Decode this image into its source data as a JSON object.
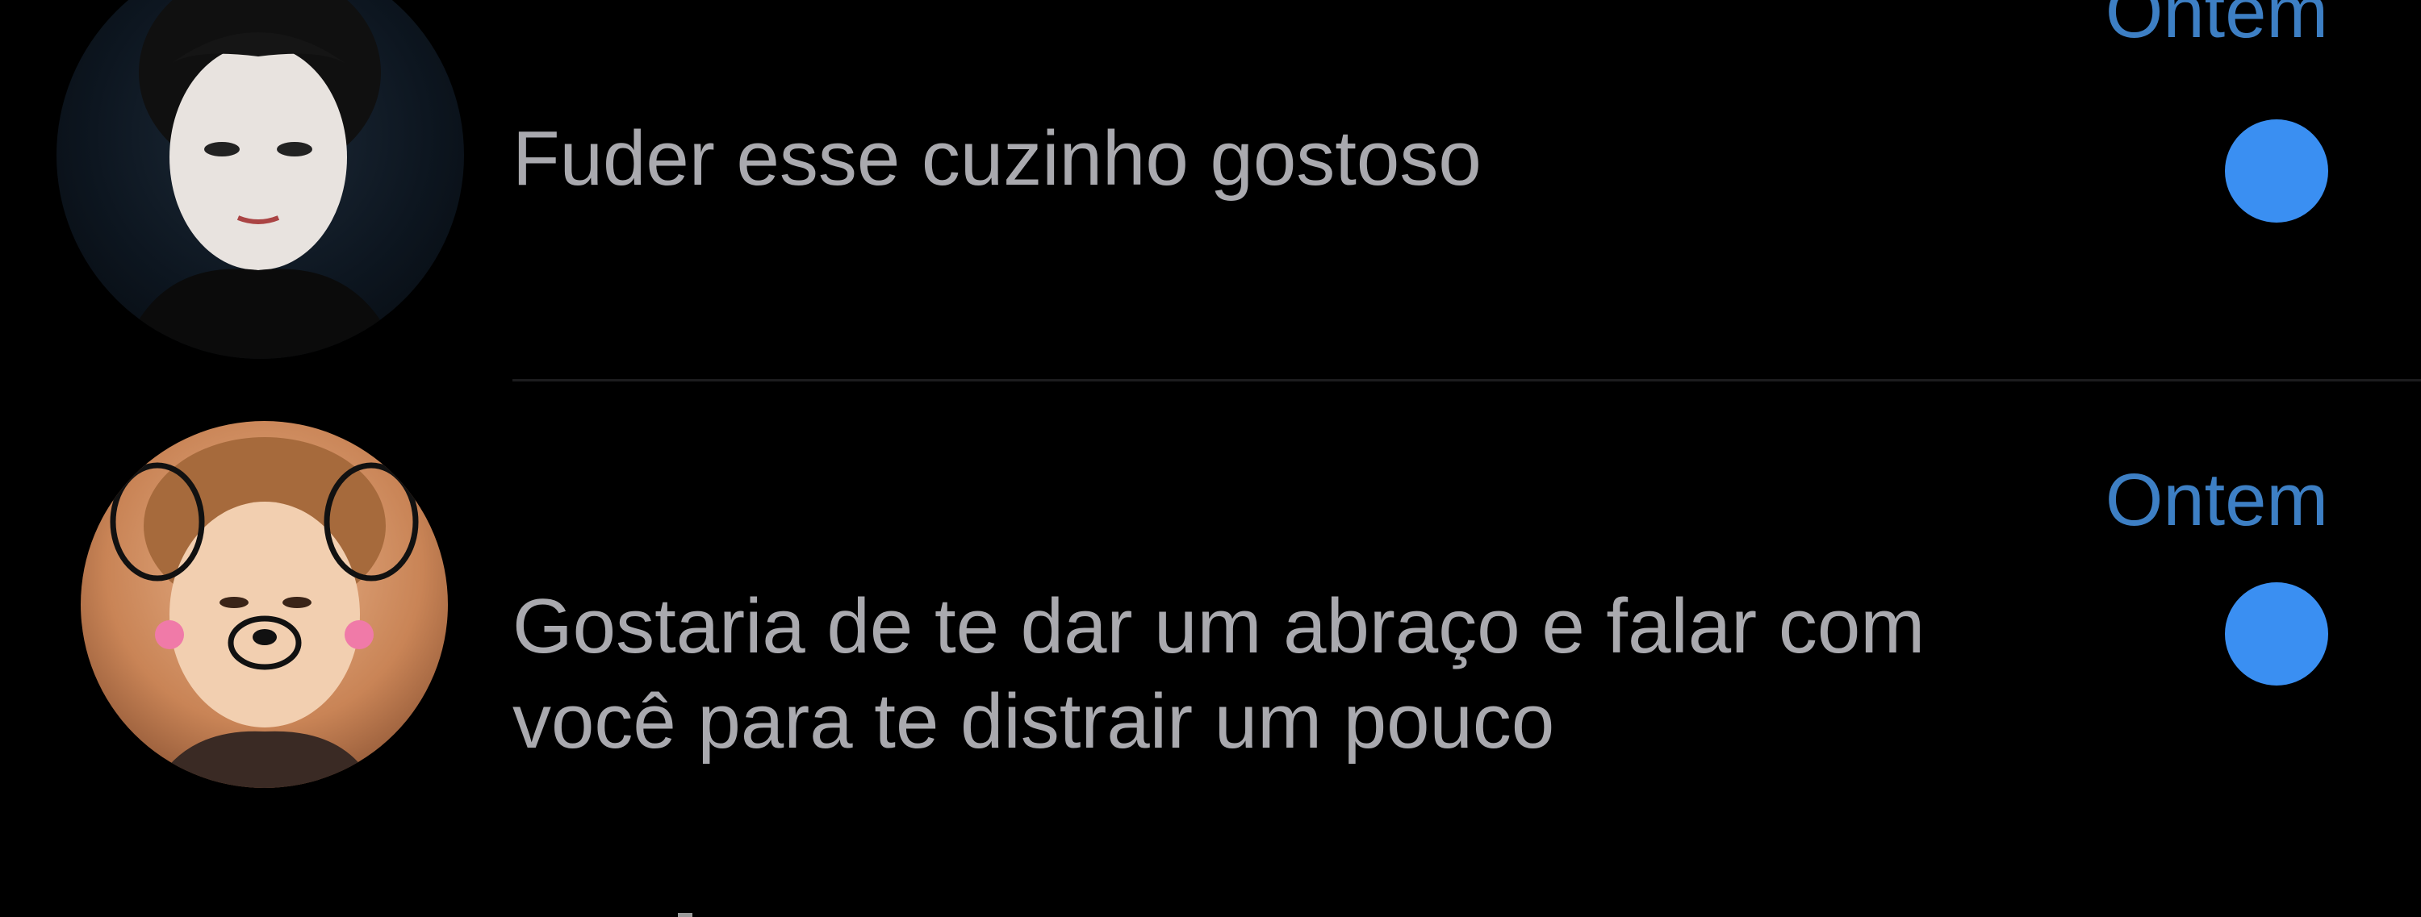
{
  "conversations": [
    {
      "avatar": "profile-photo",
      "timestamp": "Ontem",
      "message": "Fuder esse cuzinho gostoso",
      "unread": true
    },
    {
      "avatar": "profile-photo",
      "timestamp": "Ontem",
      "message": "Gostaria de te dar um abraço e falar com você para te distrair um pouco",
      "unread": true
    }
  ],
  "colors": {
    "background": "#000000",
    "message_text": "#a9a9ae",
    "timestamp": "#3d7fc4",
    "unread_dot": "#3a8ff2"
  }
}
